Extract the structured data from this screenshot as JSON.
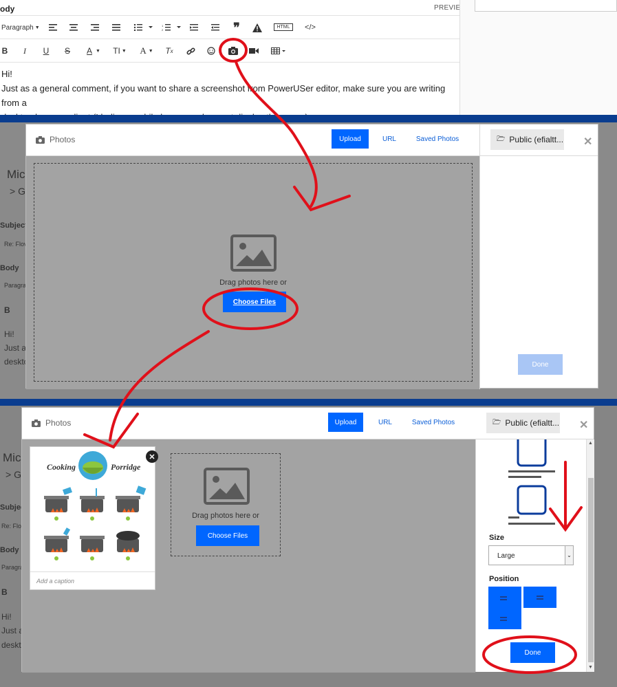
{
  "editor": {
    "field_label": "ody",
    "preview_label": "PREVIEW",
    "paragraph_label": "Paragraph",
    "html_label": "HTML",
    "body_lines": [
      "Hi!",
      "Just as a general comment, if you want to share a screenshot from PowerUSer editor, make sure you are writing from a",
      "desktop browser client (I believe mobile browsers does not display this menu):"
    ]
  },
  "background_page": {
    "title": "Mic",
    "breadcrumb": "> G",
    "subject_label": "Subject",
    "subject_value": "Re: Flov",
    "body_label": "Body",
    "paragraph_cut": "Paragra",
    "bold_icon": "B",
    "hi": "Hi!",
    "just": "Just as",
    "deskt": "deskto"
  },
  "modal1": {
    "title": "Photos",
    "tabs": [
      "Upload",
      "URL",
      "Saved Photos"
    ],
    "folder_label": "Public (efialtt...",
    "drag_text": "Drag photos here or",
    "choose_label": "Choose Files",
    "done_label": "Done"
  },
  "modal2": {
    "title": "Photos",
    "tabs": [
      "Upload",
      "URL",
      "Saved Photos"
    ],
    "folder_label": "Public (efialtt...",
    "drag_text": "Drag photos here or",
    "choose_label": "Choose Files",
    "caption_placeholder": "Add a caption",
    "image": {
      "title_left": "Cooking",
      "title_right": "Porridge"
    },
    "size_label": "Size",
    "size_value": "Large",
    "position_label": "Position",
    "done_label": "Done"
  },
  "colors": {
    "accent": "#0066ff",
    "annotation": "#e0101a",
    "dim": "#7d7d7d"
  }
}
